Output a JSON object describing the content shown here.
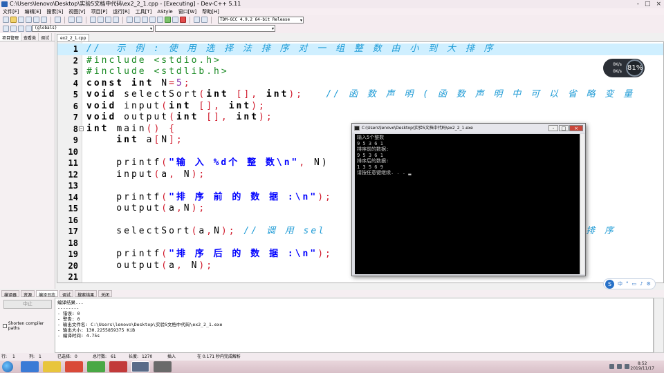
{
  "window": {
    "title": "C:\\Users\\lenovo\\Desktop\\实验5文档中代码\\ex2_2_1.cpp - [Executing] - Dev-C++ 5.11",
    "controls": [
      "-",
      "□",
      "×"
    ]
  },
  "menu": [
    "文件[F]",
    "编辑[E]",
    "搜索[S]",
    "视图[V]",
    "项目[P]",
    "运行[R]",
    "工具[T]",
    "AStyle",
    "窗口[W]",
    "帮助[H]"
  ],
  "toolbar": {
    "compiler": "TDM-GCC 4.9.2 64-bit Release",
    "scope": "(globals)"
  },
  "left_panel": {
    "tabs": [
      "项目管理",
      "查看类",
      "调试"
    ]
  },
  "editor": {
    "file_tab": "ex2_2_1.cpp",
    "lines": [
      {
        "n": "1",
        "tokens": [
          {
            "c": "cmt",
            "t": "//  示 例 : 使 用 选 择 法 排 序 对 一 组 整 数 由 小 到 大 排 序"
          }
        ]
      },
      {
        "n": "2",
        "tokens": [
          {
            "c": "pp",
            "t": "#include <stdio.h>"
          }
        ]
      },
      {
        "n": "3",
        "tokens": [
          {
            "c": "pp",
            "t": "#include <stdlib.h>"
          }
        ]
      },
      {
        "n": "4",
        "tokens": [
          {
            "c": "kw",
            "t": "const int "
          },
          {
            "c": "plain",
            "t": "N"
          },
          {
            "c": "sym",
            "t": "="
          },
          {
            "c": "num",
            "t": "5"
          },
          {
            "c": "sym",
            "t": ";"
          }
        ]
      },
      {
        "n": "5",
        "tokens": [
          {
            "c": "kw",
            "t": "void "
          },
          {
            "c": "plain",
            "t": "selectSort"
          },
          {
            "c": "sym",
            "t": "("
          },
          {
            "c": "kw",
            "t": "int "
          },
          {
            "c": "sym",
            "t": "[], "
          },
          {
            "c": "kw",
            "t": "int"
          },
          {
            "c": "sym",
            "t": ");"
          },
          {
            "c": "cmt",
            "t": "   // 函 数 声 明 ( 函 数 声 明 中 可 以 省 略 变 量"
          }
        ]
      },
      {
        "n": "6",
        "tokens": [
          {
            "c": "kw",
            "t": "void "
          },
          {
            "c": "plain",
            "t": "input"
          },
          {
            "c": "sym",
            "t": "("
          },
          {
            "c": "kw",
            "t": "int "
          },
          {
            "c": "sym",
            "t": "[], "
          },
          {
            "c": "kw",
            "t": "int"
          },
          {
            "c": "sym",
            "t": ");"
          }
        ]
      },
      {
        "n": "7",
        "tokens": [
          {
            "c": "kw",
            "t": "void "
          },
          {
            "c": "plain",
            "t": "output"
          },
          {
            "c": "sym",
            "t": "("
          },
          {
            "c": "kw",
            "t": "int "
          },
          {
            "c": "sym",
            "t": "[], "
          },
          {
            "c": "kw",
            "t": "int"
          },
          {
            "c": "sym",
            "t": ");"
          }
        ]
      },
      {
        "n": "8",
        "fold": true,
        "tokens": [
          {
            "c": "kw",
            "t": "int "
          },
          {
            "c": "plain",
            "t": "main"
          },
          {
            "c": "sym",
            "t": "() {"
          }
        ]
      },
      {
        "n": "9",
        "tokens": [
          {
            "c": "kw",
            "t": "    int "
          },
          {
            "c": "plain",
            "t": "a"
          },
          {
            "c": "sym",
            "t": "["
          },
          {
            "c": "plain",
            "t": "N"
          },
          {
            "c": "sym",
            "t": "];"
          }
        ]
      },
      {
        "n": "10",
        "tokens": []
      },
      {
        "n": "11",
        "tokens": [
          {
            "c": "plain",
            "t": "    printf"
          },
          {
            "c": "sym",
            "t": "("
          },
          {
            "c": "str",
            "t": "\"输 入 %d个 整 数\\n\""
          },
          {
            "c": "sym",
            "t": ", "
          },
          {
            "c": "plain",
            "t": "N)"
          }
        ]
      },
      {
        "n": "12",
        "tokens": [
          {
            "c": "plain",
            "t": "    input"
          },
          {
            "c": "sym",
            "t": "("
          },
          {
            "c": "plain",
            "t": "a"
          },
          {
            "c": "sym",
            "t": ", "
          },
          {
            "c": "plain",
            "t": "N"
          },
          {
            "c": "sym",
            "t": ");"
          }
        ]
      },
      {
        "n": "13",
        "tokens": []
      },
      {
        "n": "14",
        "tokens": [
          {
            "c": "plain",
            "t": "    printf"
          },
          {
            "c": "sym",
            "t": "("
          },
          {
            "c": "str",
            "t": "\"排 序 前 的 数 据 :\\n\""
          },
          {
            "c": "sym",
            "t": ");"
          }
        ]
      },
      {
        "n": "15",
        "tokens": [
          {
            "c": "plain",
            "t": "    output"
          },
          {
            "c": "sym",
            "t": "("
          },
          {
            "c": "plain",
            "t": "a"
          },
          {
            "c": "sym",
            "t": ","
          },
          {
            "c": "plain",
            "t": "N"
          },
          {
            "c": "sym",
            "t": ");"
          }
        ]
      },
      {
        "n": "16",
        "tokens": []
      },
      {
        "n": "17",
        "tokens": [
          {
            "c": "plain",
            "t": "    selectSort"
          },
          {
            "c": "sym",
            "t": "("
          },
          {
            "c": "plain",
            "t": "a"
          },
          {
            "c": "sym",
            "t": ","
          },
          {
            "c": "plain",
            "t": "N"
          },
          {
            "c": "sym",
            "t": ");"
          },
          {
            "c": "cmt",
            "t": " // 调 用 sel"
          }
        ]
      },
      {
        "n": "18",
        "tokens": []
      },
      {
        "n": "19",
        "tokens": [
          {
            "c": "plain",
            "t": "    printf"
          },
          {
            "c": "sym",
            "t": "("
          },
          {
            "c": "str",
            "t": "\"排 序 后 的 数 据 :\\n\""
          },
          {
            "c": "sym",
            "t": ");"
          }
        ]
      },
      {
        "n": "20",
        "tokens": [
          {
            "c": "plain",
            "t": "    output"
          },
          {
            "c": "sym",
            "t": "("
          },
          {
            "c": "plain",
            "t": "a"
          },
          {
            "c": "sym",
            "t": ", "
          },
          {
            "c": "plain",
            "t": "N"
          },
          {
            "c": "sym",
            "t": ");"
          }
        ]
      },
      {
        "n": "21",
        "tokens": []
      }
    ],
    "peek_text": "排 序"
  },
  "console": {
    "title": "C:\\Users\\lenovo\\Desktop\\实验5文档中代码\\ex2_2_1.exe",
    "output": "输入5个整数\n9 5 3 6 1\n排序前的数据:\n9 5 3 6 1\n排序后的数据:\n1 3 5 6 9\n请按任意键继续. . . ▂"
  },
  "meter": {
    "percent": "81%",
    "row1": "0K/s",
    "row2": "0K/s"
  },
  "ime": {
    "logo": "S",
    "label": "中"
  },
  "bottom_tabs": [
    "编译器",
    "资源",
    "编译日志",
    "调试",
    "搜索结果",
    "关闭"
  ],
  "bottom_panel": {
    "abort_label": "中止",
    "shorten_label": "Shorten compiler paths",
    "log": "编译结果...\n--------\n- 错误: 0\n- 警告: 0\n- 输出文件名: C:\\Users\\lenovo\\Desktop\\实验5文档中代码\\ex2_2_1.exe\n- 输出大小: 130.2255859375 KiB\n- 编译时间: 4.75s"
  },
  "status": {
    "row": "行:",
    "row_val": "1",
    "col": "列:",
    "col_val": "1",
    "sel": "已选择:",
    "sel_val": "0",
    "total": "总行数:",
    "total_val": "61",
    "len": "长度:",
    "len_val": "1270",
    "mode": "插入",
    "parse": "在 0.171 秒内完成解析"
  },
  "taskbar": {
    "time": "8:52",
    "date": "2019/11/17"
  }
}
